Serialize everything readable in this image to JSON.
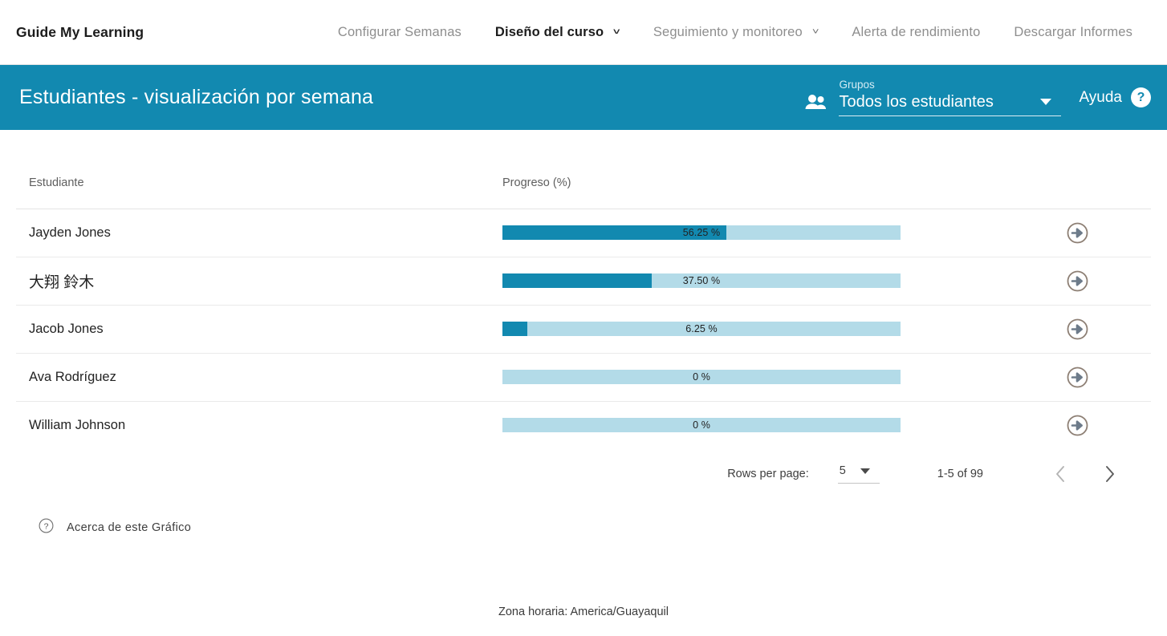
{
  "topnav": {
    "brand": "Guide My Learning",
    "items": [
      {
        "label": "Configurar Semanas",
        "has_caret": false,
        "active": false
      },
      {
        "label": "Diseño del curso",
        "has_caret": true,
        "active": true
      },
      {
        "label": "Seguimiento y monitoreo",
        "has_caret": true,
        "active": false
      },
      {
        "label": "Alerta de rendimiento",
        "has_caret": false,
        "active": false
      },
      {
        "label": "Descargar Informes",
        "has_caret": false,
        "active": false
      }
    ]
  },
  "pagehead": {
    "title": "Estudiantes - visualización por semana",
    "group_label": "Grupos",
    "group_value": "Todos los estudiantes",
    "help_label": "Ayuda",
    "help_badge": "?",
    "accent_color": "#1289b0"
  },
  "table": {
    "columns": [
      "Estudiante",
      "Progreso (%)"
    ],
    "rows": [
      {
        "student": "Jayden Jones",
        "progress": 56.25,
        "progress_label": "56.25 %",
        "cjk": false
      },
      {
        "student": "大翔 鈴木",
        "progress": 37.5,
        "progress_label": "37.50 %",
        "cjk": true
      },
      {
        "student": "Jacob Jones",
        "progress": 6.25,
        "progress_label": "6.25 %",
        "cjk": false
      },
      {
        "student": "Ava Rodríguez",
        "progress": 0,
        "progress_label": "0 %",
        "cjk": false
      },
      {
        "student": "William Johnson",
        "progress": 0,
        "progress_label": "0 %",
        "cjk": false
      }
    ],
    "bar_fill_color": "#1289b0",
    "bar_track_color": "#b3dbe8",
    "row_action_icon": "arrow-circle-right-icon"
  },
  "paginator": {
    "rows_per_page_label": "Rows per page:",
    "rows_per_page_value": "5",
    "range_label": "1-5 of 99",
    "prev_icon": "chevron-left-icon",
    "next_icon": "chevron-right-icon"
  },
  "about": {
    "icon": "help-circle-icon",
    "label": "Acerca de este Gráfico"
  },
  "footer": {
    "timezone": "Zona horaria: America/Guayaquil"
  },
  "chart_data": {
    "type": "bar",
    "title": "Estudiantes - visualización por semana",
    "xlabel": "Progreso (%)",
    "ylabel": "Estudiante",
    "categories": [
      "Jayden Jones",
      "大翔 鈴木",
      "Jacob Jones",
      "Ava Rodríguez",
      "William Johnson"
    ],
    "values": [
      56.25,
      37.5,
      6.25,
      0,
      0
    ],
    "value_labels": [
      "56.25 %",
      "37.50 %",
      "6.25 %",
      "0 %",
      "0 %"
    ],
    "xlim": [
      0,
      100
    ],
    "grid": false,
    "legend": "none",
    "orientation": "horizontal"
  }
}
